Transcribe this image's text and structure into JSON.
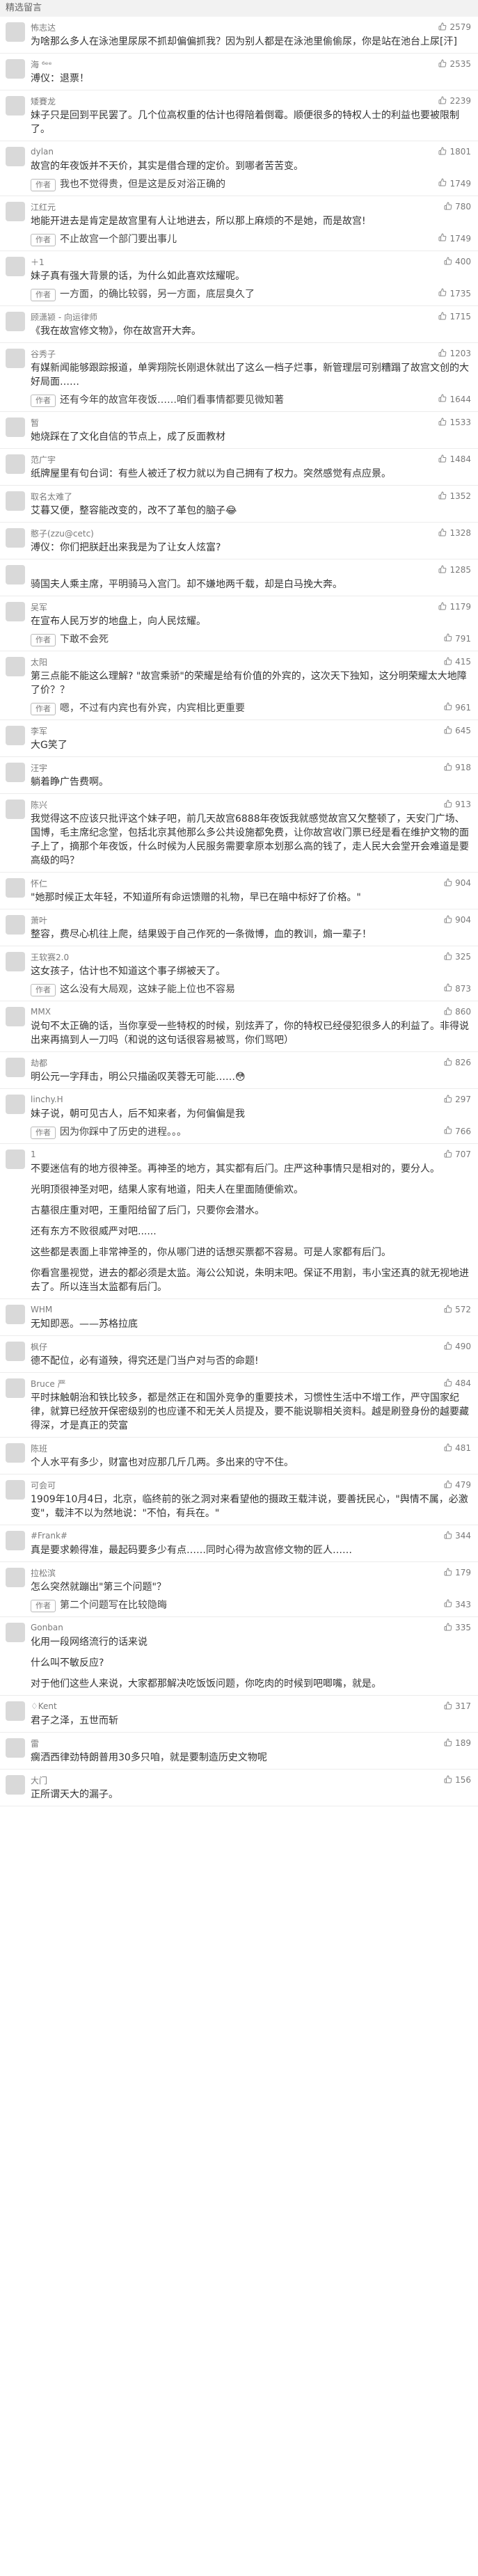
{
  "page": {
    "header": "精选留言",
    "comments": [
      {
        "author": "怖志达",
        "likes": "2579",
        "text": "为啥那么多人在泳池里尿尿不抓却偏偏抓我？因为别人都是在泳池里偷偷尿，你是站在池台上尿[汗]"
      },
      {
        "author": "海 ⁶ᵉᵉ",
        "likes": "2535",
        "text": "溥仪：退票！"
      },
      {
        "author": "矮賽龙",
        "likes": "2239",
        "text": "妹子只是回到平民罢了。几个位高权重的估计也得陪着倒霉。顺便很多的特权人士的利益也要被限制了。"
      },
      {
        "author": "dylan",
        "likes": "1801",
        "text": "故宫的年夜饭并不天价，其实是借合理的定价。到哪者苦苦变。",
        "author_reply": "我也不觉得贵，但是这是反对浴正确的",
        "author_reply_likes": "1749"
      },
      {
        "author": "江红元",
        "likes": "780",
        "text": "地能开进去是肯定是故宫里有人让地进去，所以那上麻烦的不是她，而是故宫!",
        "author_reply": "不止故宫一个部门要出事儿",
        "author_reply_likes": "1749"
      },
      {
        "author": "＋1",
        "likes": "400",
        "text": "妹子真有强大背景的话，为什么如此喜欢炫耀呢。",
        "author_reply": "一方面，的确比较弱，另一方面，底层臭久了",
        "author_reply_likes": "1735"
      },
      {
        "author": "顾潇颍 - 向运律师",
        "likes": "1715",
        "text": "《我在故宫修文物》，你在故宫开大奔。"
      },
      {
        "author": "谷秀子",
        "likes": "1203",
        "text": "有媒新闻能够跟踪报道，单霁翔院长刚退休就出了这么一档子烂事，新管理层可别糟蹋了故宫文创的大好局面……",
        "author_reply": "还有今年的故宫年夜饭……咱们看事情都要见微知著",
        "author_reply_likes": "1644"
      },
      {
        "author": "暂",
        "likes": "1533",
        "text": "她烧踩在了文化自信的节点上，成了反面教材"
      },
      {
        "author": "范广宇",
        "likes": "1484",
        "text": "纸牌屋里有句台词：有些人被迁了权力就以为自己拥有了权力。突然感觉有点应景。"
      },
      {
        "author": "取名太难了",
        "likes": "1352",
        "text": "艾暮又便，整容能改变的，改不了革包的脑子😂"
      },
      {
        "author": "憨子(zzu@cetc)",
        "likes": "1328",
        "text": "溥仪：你们把朕赶出来我是为了让女人炫富?"
      },
      {
        "author": "",
        "likes": "1285",
        "text": "骑国夫人乘主席，平明骑马入宫门。却不嫌地两千载，却是白马挽大奔。"
      },
      {
        "author": "吴军",
        "likes": "1179",
        "text": "在宣布人民万岁的地盘上，向人民炫耀。",
        "author_reply": "下敢不会死",
        "author_reply_likes": "791"
      },
      {
        "author": "太阳",
        "likes": "415",
        "text": "第三点能不能这么理解? \"故宫乘骄\"的荣耀是给有价值的外宾的，这次天下独知，这分明荣耀太大地障了价？？",
        "author_reply": "嗯，不过有内宾也有外宾，内宾相比更重要",
        "author_reply_likes": "961"
      },
      {
        "author": "李军",
        "likes": "645",
        "text": "大G笑了"
      },
      {
        "author": "汪宇",
        "likes": "918",
        "text": "躺着睁广告费啊。"
      },
      {
        "author": "陈兴",
        "likes": "913",
        "text": "我觉得这不应该只批评这个妹子吧，前几天故宫6888年夜饭我就感觉故宫又欠整顿了，天安门广场、国博，毛主席纪念堂，包括北京其他那么多公共设施都免费，让你故宫收门票已经是看在维护文物的面子上了，摘那个年夜饭，什么时候为人民服务需要拿原本划那么高的钱了，走人民大会堂开会难道是要高级的吗？"
      },
      {
        "author": "怀仁",
        "likes": "904",
        "text": "\"她那时候正太年轻，不知道所有命运馈赠的礼物，早已在暗中标好了价格。\""
      },
      {
        "author": "萧叶",
        "likes": "904",
        "text": "整容，费尽心机往上爬，结果毁于自己作死的一条微博，血的教训，煽一辈子！"
      },
      {
        "author": "王软赛2.0",
        "likes": "325",
        "text": "这女孩子，估计也不知道这个事子绑被天了。",
        "author_reply": "这么没有大局观，这妹子能上位也不容易",
        "author_reply_likes": "873"
      },
      {
        "author": "MMX",
        "likes": "860",
        "text": "说句不太正确的话，当你享受一些特权的时候，别炫弄了，你的特权已经侵犯很多人的利益了。非得说出来再搞到人一刀吗（和说的这句话很容易被骂，你们骂吧）"
      },
      {
        "author": "劫都",
        "likes": "826",
        "text": "明公元一字拜击，明公只描函叹芙蓉无可能……😳"
      },
      {
        "author": "linchy.H",
        "likes": "297",
        "text": "妹子说，朝可见古人，后不知来者，为何偏偏是我",
        "author_reply": "因为你踩中了历史的进程。。。",
        "author_reply_likes": "766"
      },
      {
        "author": "1",
        "likes": "707",
        "paragraphs": [
          "不要迷信有的地方很神圣。再神圣的地方，其实都有后门。庄严这种事情只是相对的，要分人。",
          "光明顶很神圣对吧，结果人家有地道，阳夫人在里面随便偷欢。",
          "古墓很庄重对吧，王重阳给留了后门，只要你会潜水。",
          "还有东方不败很威严对吧......",
          "这些都是表面上非常神圣的，你从哪门进的话想买票都不容易。可是人家都有后门。",
          "你看宫墨视觉，进去的都必须是太监。海公公知说，朱明末吧。保证不用割，韦小宝还真的就无视地进去了。所以连当太监都有后门。"
        ]
      },
      {
        "author": "WHM",
        "likes": "572",
        "text": "无知即恶。——苏格拉底"
      },
      {
        "author": "枫仔",
        "likes": "490",
        "text": "德不配位，必有道殃，得究还是门当户对与否的命题!"
      },
      {
        "author": "Bruce 严",
        "likes": "484",
        "text": "平时抹触朝治和铁比较多，都是然正在和国外竞争的重要技术，习惯性生活中不增工作，严守国家纪律，就算已经放开保密级别的也应谨不和无关人员提及，要不能说聊相关资料。越是刷登身份的越要藏得深，才是真正的荧富"
      },
      {
        "author": "陈班",
        "likes": "481",
        "text": "个人水平有多少，财富也对应那几斤几两。多出来的守不住。"
      },
      {
        "author": "可会可",
        "likes": "479",
        "text": "1909年10月4日，北京，临终前的张之洞对来看望他的摄政王载沣说，要善抚民心，\"舆情不属，必激变\"，载沣不以为然地说：\"不怕，有兵在。\""
      },
      {
        "author": "#Frank#",
        "likes": "344",
        "text": "真是要求赖得准，最起码要多少有点……同时心得为故宫修文物的匠人……"
      },
      {
        "author": "拉松滨",
        "likes": "179",
        "text": "怎么突然就蹦出\"第三个问题\"？",
        "author_reply": "第二个问题写在比较隐晦",
        "author_reply_likes": "343"
      },
      {
        "author": "Gonban",
        "likes": "335",
        "paragraphs": [
          "化用一段网络流行的话来说",
          "什么叫不敏反应?",
          "对于他们这些人来说，大家都那解决吃饭饭问题，你吃肉的时候到吧唧嘴，就是。"
        ]
      },
      {
        "author": "♢Kent",
        "likes": "317",
        "text": "君子之泽，五世而斩",
        "star": true
      },
      {
        "author": "雷",
        "likes": "189",
        "text": "瘸洒西律劲特朗普用30多只咱，就是要制造历史文物呢"
      },
      {
        "author": "大门",
        "likes": "156",
        "text": "正所谓天大的漏子。"
      }
    ]
  }
}
